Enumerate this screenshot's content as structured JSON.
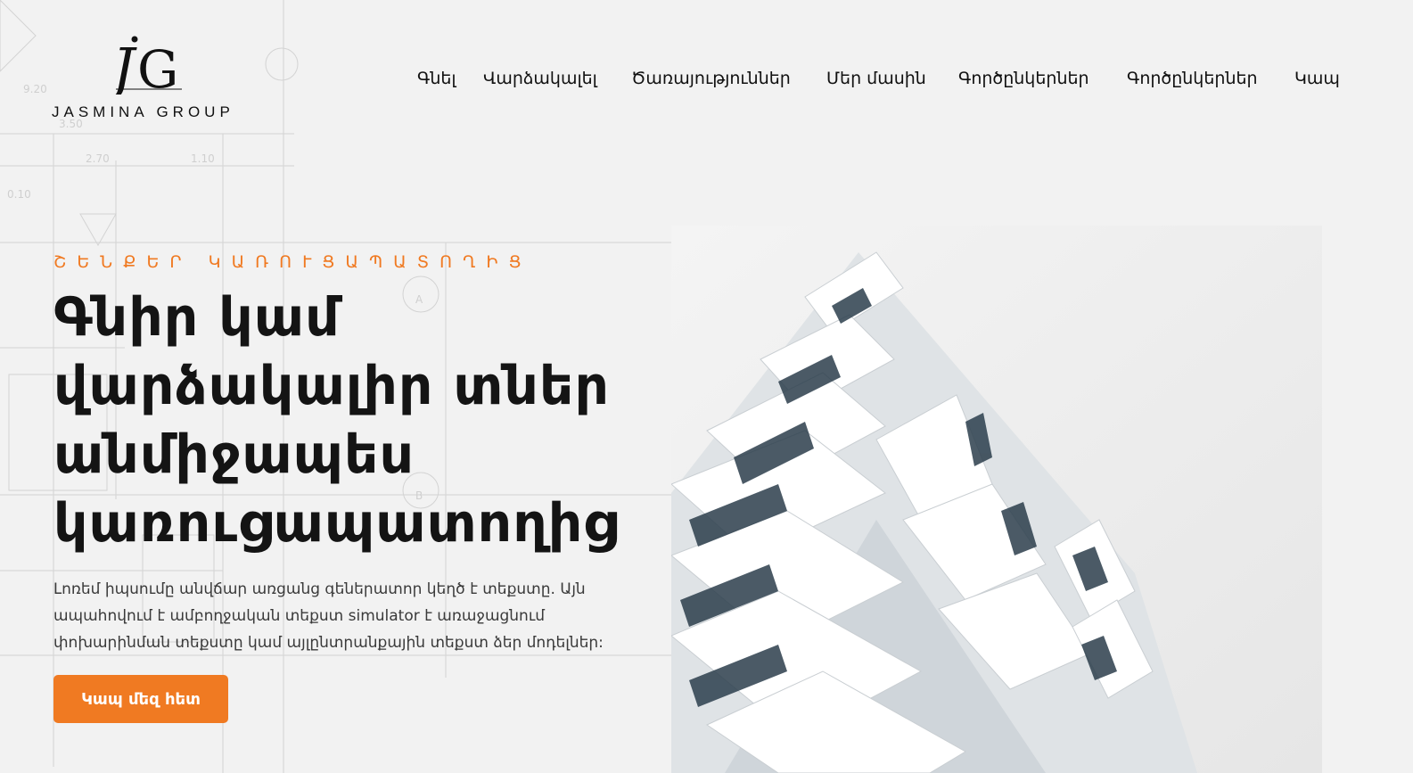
{
  "site": {
    "brand_name": "JASMINA GROUP",
    "logo_mark": "JG",
    "accent_color": "#f07a22"
  },
  "nav": {
    "items": [
      {
        "label": "Գնել"
      },
      {
        "label": "Վարձակալել"
      },
      {
        "label": "Ծառայություններ"
      },
      {
        "label": "Մեր մասին"
      },
      {
        "label": "Գործընկերներ"
      },
      {
        "label": "Գործընկերներ"
      },
      {
        "label": "Կապ"
      }
    ]
  },
  "hero": {
    "eyebrow": "ՇԵՆՔԵՐ ԿԱՌՈՒՑԱՊԱՏՈՂԻՑ",
    "title_lines": [
      "Գնիր կամ",
      "վարձակալիր տներ",
      "անմիջապես",
      "կառուցապատողից"
    ],
    "description_lines": [
      "Լոռեմ իպսումը անվճար առցանց գեներատոր կեղծ է տեքստը. Այն",
      "ապահովում է ամբողջական տեքստ simulator է առաջացնում",
      "փոխարինման տեքստը կամ այլընտրանքային տեքստ ձեր մոդելներ:"
    ],
    "cta_label": "Կապ մեզ հետ",
    "image_icon": "building-photo"
  }
}
